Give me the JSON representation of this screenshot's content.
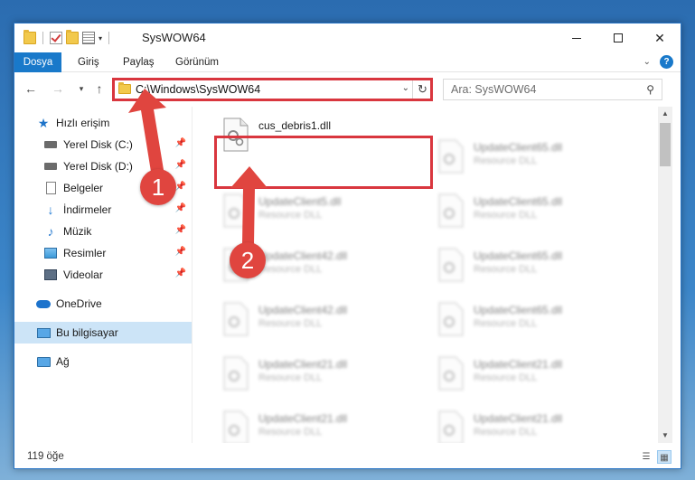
{
  "window": {
    "title": "SysWOW64",
    "controls": {
      "minimize": "—",
      "maximize": "☐",
      "close": "✕"
    }
  },
  "ribbon": {
    "tabs": [
      {
        "label": "Dosya",
        "active": true
      },
      {
        "label": "Giriş"
      },
      {
        "label": "Paylaş"
      },
      {
        "label": "Görünüm"
      }
    ],
    "help": "?"
  },
  "navigation": {
    "back": "←",
    "forward": "→",
    "recent": "▾",
    "up": "↑",
    "address": "C:\\Windows\\SysWOW64",
    "address_dropdown": "⌄",
    "refresh": "↻",
    "search_placeholder": "Ara: SysWOW64",
    "search_icon": "⚲"
  },
  "sidebar": {
    "items": [
      {
        "label": "Hızlı erişim",
        "icon": "star-icon"
      },
      {
        "label": "Yerel Disk (C:)",
        "icon": "drive-icon",
        "pinned": true
      },
      {
        "label": "Yerel Disk (D:)",
        "icon": "drive-icon",
        "pinned": true
      },
      {
        "label": "Belgeler",
        "icon": "documents-icon",
        "pinned": true
      },
      {
        "label": "İndirmeler",
        "icon": "downloads-icon",
        "pinned": true
      },
      {
        "label": "Müzik",
        "icon": "music-icon",
        "pinned": true
      },
      {
        "label": "Resimler",
        "icon": "pictures-icon",
        "pinned": true
      },
      {
        "label": "Videolar",
        "icon": "videos-icon",
        "pinned": true
      },
      {
        "label": "OneDrive",
        "icon": "onedrive-icon"
      },
      {
        "label": "Bu bilgisayar",
        "icon": "this-pc-icon",
        "selected": true
      },
      {
        "label": "Ağ",
        "icon": "network-icon"
      }
    ],
    "pin_glyph": "📌"
  },
  "files": {
    "highlighted": {
      "name": "cus_debris1.dll"
    },
    "column1": [
      {
        "name": "UpdateClient5.dll",
        "type": "Resource DLL"
      },
      {
        "name": "UpdateClient42.dll",
        "type": "Resource DLL"
      },
      {
        "name": "UpdateClient42.dll",
        "type": "Resource DLL"
      },
      {
        "name": "UpdateClient21.dll",
        "type": "Resource DLL"
      },
      {
        "name": "UpdateClient21.dll",
        "type": "Resource DLL"
      }
    ],
    "column2": [
      {
        "name": "UpdateClient65.dll",
        "type": "Resource DLL"
      },
      {
        "name": "UpdateClient65.dll",
        "type": "Resource DLL"
      },
      {
        "name": "UpdateClient65.dll",
        "type": "Resource DLL"
      },
      {
        "name": "UpdateClient65.dll",
        "type": "Resource DLL"
      },
      {
        "name": "UpdateClient21.dll",
        "type": "Resource DLL"
      },
      {
        "name": "UpdateClient21.dll",
        "type": "Resource DLL"
      }
    ]
  },
  "status": {
    "item_count": "119 öğe"
  },
  "annotations": {
    "callout1": "1",
    "callout2": "2",
    "highlight_color": "#d9363e",
    "callout_color": "#e0453f"
  },
  "colors": {
    "accent": "#1979ca",
    "selection": "#cce4f7"
  }
}
